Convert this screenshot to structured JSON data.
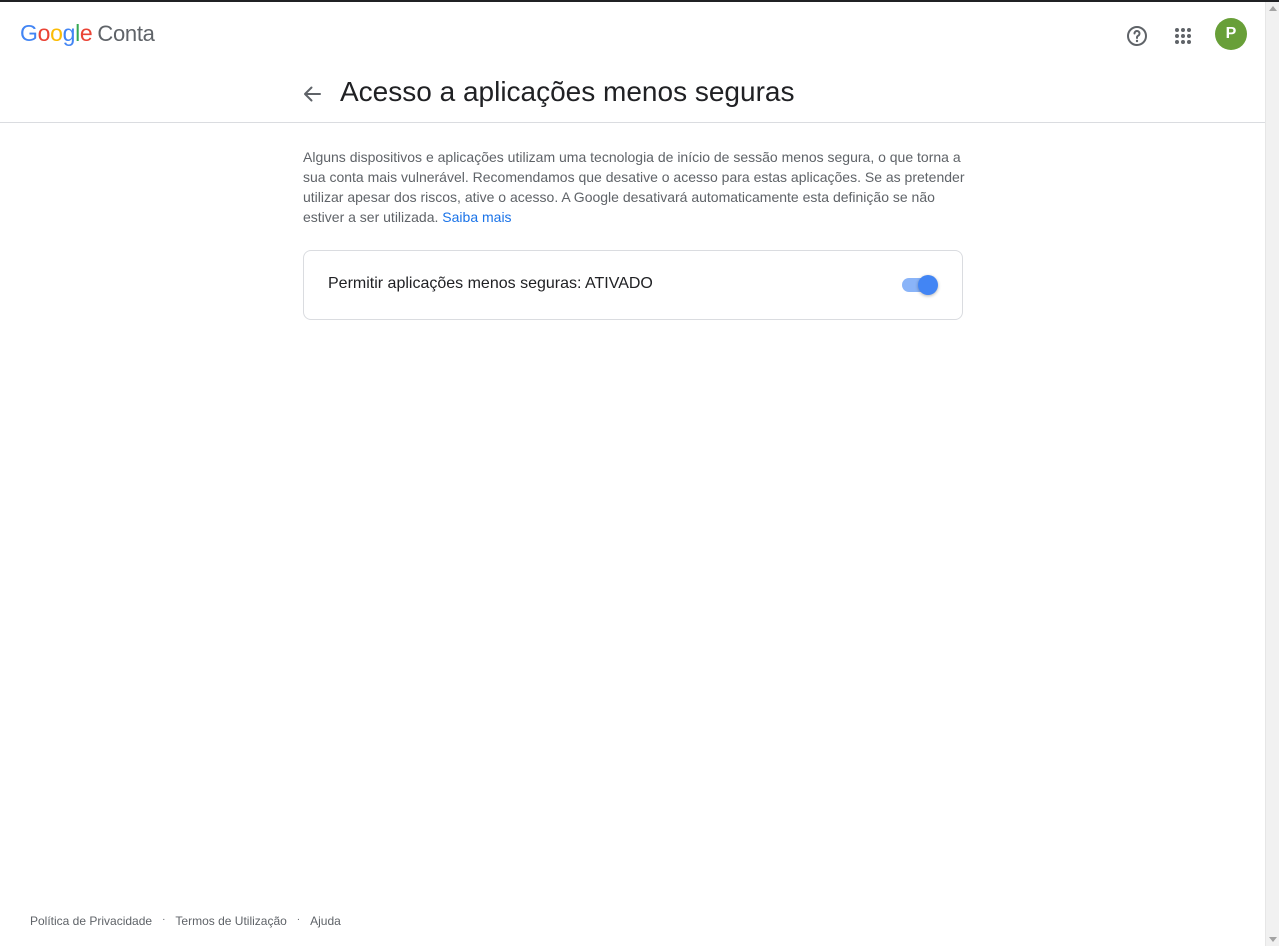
{
  "header": {
    "logo_letters": [
      {
        "char": "G",
        "color": "#4285f4"
      },
      {
        "char": "o",
        "color": "#ea4335"
      },
      {
        "char": "o",
        "color": "#fbbc05"
      },
      {
        "char": "g",
        "color": "#4285f4"
      },
      {
        "char": "l",
        "color": "#34a853"
      },
      {
        "char": "e",
        "color": "#ea4335"
      }
    ],
    "product_name": "Conta",
    "help_icon": "help-circle-icon",
    "apps_icon": "apps-grid-icon",
    "avatar_initial": "P",
    "avatar_color": "#689f38"
  },
  "title_row": {
    "back_icon": "arrow-back-icon",
    "title": "Acesso a aplicações menos seguras"
  },
  "main": {
    "description": "Alguns dispositivos e aplicações utilizam uma tecnologia de início de sessão menos segura, o que torna a sua conta mais vulnerável. Recomendamos que desative o acesso para estas aplicações. Se as pretender utilizar apesar dos riscos, ative o acesso. A Google desativará automaticamente esta definição se não estiver a ser utilizada.",
    "learn_more": "Saiba mais",
    "setting_label": "Permitir aplicações menos seguras: ATIVADO",
    "toggle_on": true,
    "accent_color": "#4285f4"
  },
  "footer": {
    "privacy": "Política de Privacidade",
    "separator": "·",
    "terms": "Termos de Utilização",
    "help": "Ajuda"
  }
}
